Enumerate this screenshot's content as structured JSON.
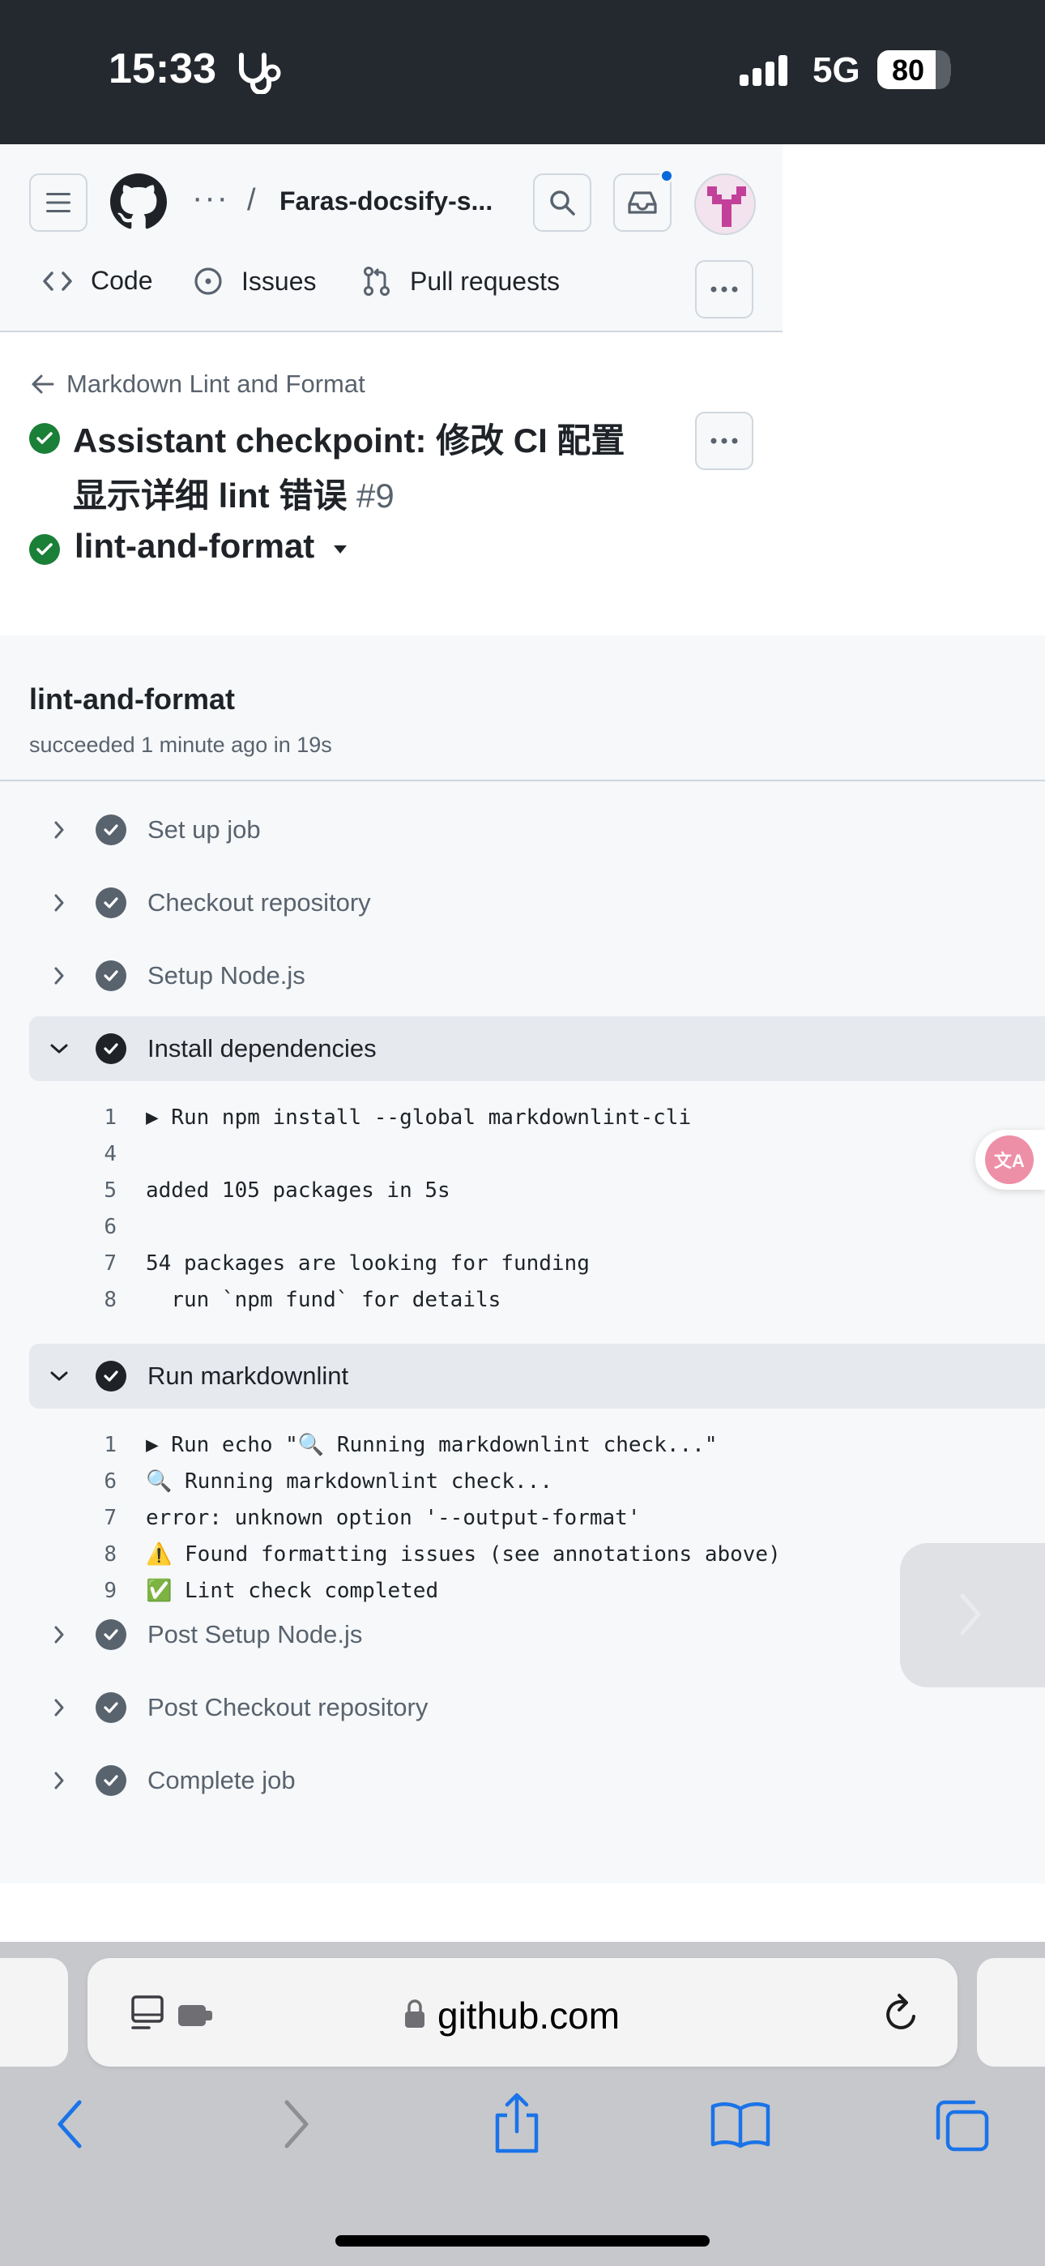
{
  "status_bar": {
    "time": "15:33",
    "network": "5G",
    "battery": "80",
    "battery_level": 0.8
  },
  "header": {
    "breadcrumb_ellipsis": "···",
    "breadcrumb_separator": "/",
    "repo_name": "Faras-docsify-s...",
    "nav": {
      "code": "Code",
      "issues": "Issues",
      "pull_requests": "Pull requests"
    },
    "more_label": "···",
    "notification_color": "#0969da"
  },
  "run": {
    "back_link": "Markdown Lint and Format",
    "title": "Assistant checkpoint: 修改 CI 配置显示详细 lint 错误",
    "number": "#9",
    "job_selector": "lint-and-format"
  },
  "job": {
    "name": "lint-and-format",
    "summary": "succeeded 1 minute ago in 19s",
    "steps": [
      {
        "label": "Set up job",
        "expanded": false
      },
      {
        "label": "Checkout repository",
        "expanded": false
      },
      {
        "label": "Setup Node.js",
        "expanded": false
      },
      {
        "label": "Install dependencies",
        "expanded": true,
        "log": [
          {
            "n": "1",
            "text": "▶ Run npm install --global markdownlint-cli"
          },
          {
            "n": "4",
            "text": ""
          },
          {
            "n": "5",
            "text": "added 105 packages in 5s"
          },
          {
            "n": "6",
            "text": ""
          },
          {
            "n": "7",
            "text": "54 packages are looking for funding"
          },
          {
            "n": "8",
            "text": "  run `npm fund` for details"
          }
        ]
      },
      {
        "label": "Run markdownlint",
        "expanded": true,
        "log": [
          {
            "n": "1",
            "text": "▶ Run echo \"🔍 Running markdownlint check...\""
          },
          {
            "n": "6",
            "text": "🔍 Running markdownlint check..."
          },
          {
            "n": "7",
            "text": "error: unknown option '--output-format'"
          },
          {
            "n": "8",
            "text": "⚠️ Found formatting issues (see annotations above)"
          },
          {
            "n": "9",
            "text": "✅ Lint check completed"
          }
        ]
      },
      {
        "label": "Post Setup Node.js",
        "expanded": false
      },
      {
        "label": "Post Checkout repository",
        "expanded": false
      },
      {
        "label": "Complete job",
        "expanded": false
      }
    ]
  },
  "browser": {
    "url": "github.com"
  },
  "colors": {
    "success": "#1a7f37",
    "accent": "#0969da",
    "safari_blue": "#1a73e8"
  }
}
